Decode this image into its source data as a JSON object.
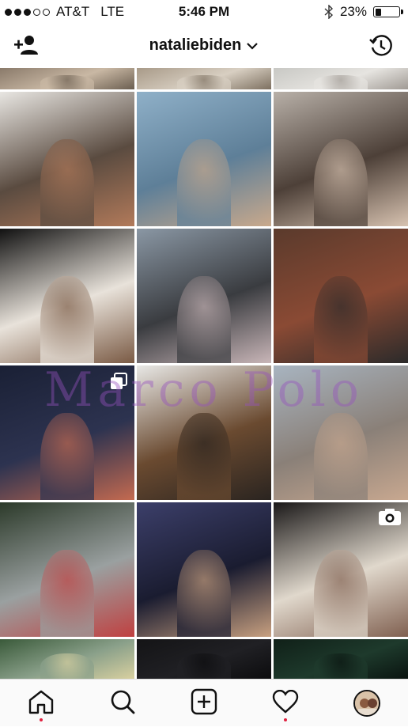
{
  "status_bar": {
    "carrier": "AT&T",
    "network": "LTE",
    "time": "5:46 PM",
    "battery_percent": "23%",
    "battery_level": 0.23,
    "signal_bars_filled": 3,
    "signal_bars_total": 5
  },
  "header": {
    "username": "nataliebiden",
    "left_icon": "add-person-icon",
    "right_icon": "history-icon",
    "dropdown_icon": "chevron-down-icon"
  },
  "watermark": {
    "text": "Marco Polo"
  },
  "grid": {
    "posts": [
      {
        "name": "post-partial-1",
        "icon": null,
        "colors": [
          "#8a7a6a",
          "#c9b8a4",
          "#6b5e50"
        ]
      },
      {
        "name": "post-partial-2",
        "icon": null,
        "colors": [
          "#a89a88",
          "#d8cfc2",
          "#7d7060"
        ]
      },
      {
        "name": "post-partial-3",
        "icon": null,
        "colors": [
          "#c8c8c4",
          "#e6e4e0",
          "#a09a94"
        ]
      },
      {
        "name": "post-porch-girls",
        "icon": null,
        "colors": [
          "#e8e6e2",
          "#5a4b40",
          "#b27a5a"
        ]
      },
      {
        "name": "post-beach-dance",
        "icon": null,
        "colors": [
          "#8fb0c8",
          "#5e7f98",
          "#c9a98c"
        ]
      },
      {
        "name": "post-three-girls",
        "icon": null,
        "colors": [
          "#b8b0a8",
          "#4d4038",
          "#d7c2b0"
        ]
      },
      {
        "name": "post-striped-wall",
        "icon": null,
        "colors": [
          "#111111",
          "#e8e2da",
          "#7a5a44"
        ]
      },
      {
        "name": "post-deck-sunset",
        "icon": null,
        "colors": [
          "#8a97a4",
          "#3a3c40",
          "#c9b6b8"
        ]
      },
      {
        "name": "post-porch-night",
        "icon": null,
        "colors": [
          "#5a3a2c",
          "#8a4a34",
          "#2b2a2a"
        ]
      },
      {
        "name": "post-rain-night",
        "icon": "multiple-photos-icon",
        "colors": [
          "#1a2035",
          "#2d3350",
          "#c46a50"
        ]
      },
      {
        "name": "post-hair-back",
        "icon": null,
        "colors": [
          "#e8e8e6",
          "#6a4a30",
          "#2a2420"
        ]
      },
      {
        "name": "post-beach-sit",
        "icon": null,
        "colors": [
          "#a8b4c0",
          "#8a8078",
          "#c8a890"
        ]
      },
      {
        "name": "post-trees-group",
        "icon": null,
        "colors": [
          "#2c3a2a",
          "#9aa0a0",
          "#c04040"
        ]
      },
      {
        "name": "post-night-hug",
        "icon": null,
        "colors": [
          "#3c3f6a",
          "#1a1c30",
          "#c8a080"
        ]
      },
      {
        "name": "post-video-party",
        "icon": "video-camera-icon",
        "colors": [
          "#1a1818",
          "#e0d8cc",
          "#806050"
        ]
      },
      {
        "name": "post-partial-4",
        "icon": null,
        "colors": [
          "#3a5a3a",
          "#8aa08a",
          "#d8d0a0"
        ]
      },
      {
        "name": "post-partial-5",
        "icon": null,
        "colors": [
          "#141416",
          "#202024",
          "#0c0c0e"
        ]
      },
      {
        "name": "post-partial-6",
        "icon": null,
        "colors": [
          "#102018",
          "#1e3a2c",
          "#0a1410"
        ]
      }
    ]
  },
  "tabs": [
    {
      "name": "tab-home",
      "icon": "home-icon",
      "notification": true
    },
    {
      "name": "tab-search",
      "icon": "search-icon",
      "notification": false
    },
    {
      "name": "tab-add",
      "icon": "add-post-icon",
      "notification": false
    },
    {
      "name": "tab-activity",
      "icon": "heart-icon",
      "notification": true
    },
    {
      "name": "tab-profile",
      "icon": "profile-avatar-icon",
      "notification": false
    }
  ]
}
